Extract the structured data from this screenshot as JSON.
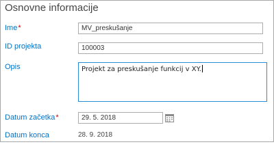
{
  "section": {
    "title": "Osnovne informacije"
  },
  "fields": {
    "name": {
      "label": "Ime",
      "required_mark": "*",
      "value": "MV_preskušanje"
    },
    "project_id": {
      "label": "ID projekta",
      "value": "100003"
    },
    "description": {
      "label": "Opis",
      "value": "Projekt za preskušanje funkcij v XY."
    },
    "start_date": {
      "label": "Datum začetka",
      "required_mark": "*",
      "value": "29. 5. 2018",
      "button_icon": "calendar-icon"
    },
    "end_date": {
      "label": "Datum konca",
      "value": "28. 9. 2018"
    }
  },
  "colors": {
    "label": "#0072c6",
    "required": "#c00000",
    "focus_border": "#2a8dd4",
    "border": "#ababab"
  }
}
